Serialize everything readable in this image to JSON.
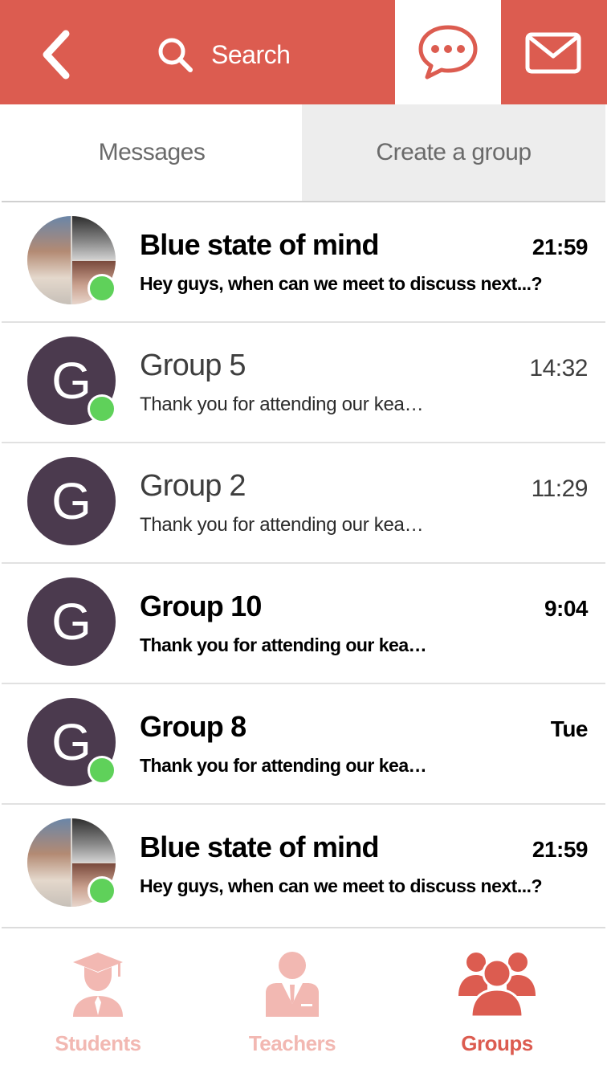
{
  "header": {
    "search_label": "Search",
    "accent_color": "#dc5c50"
  },
  "tabs": [
    {
      "label": "Messages",
      "active": true
    },
    {
      "label": "Create a group",
      "active": false
    }
  ],
  "conversations": [
    {
      "title": "Blue state of mind",
      "message": "Hey guys, when can we meet to discuss next...?",
      "time": "21:59",
      "avatar": "photo-collage",
      "online": true,
      "unread": true
    },
    {
      "title": "Group 5",
      "message": "Thank you for attending our kea…",
      "time": "14:32",
      "avatar_letter": "G",
      "online": true,
      "unread": false
    },
    {
      "title": "Group 2",
      "message": "Thank you for attending our kea…",
      "time": "11:29",
      "avatar_letter": "G",
      "online": false,
      "unread": false
    },
    {
      "title": "Group 10",
      "message": "Thank you for attending our kea…",
      "time": "9:04",
      "avatar_letter": "G",
      "online": false,
      "unread": true
    },
    {
      "title": "Group 8",
      "message": "Thank you for attending our kea…",
      "time": "Tue",
      "avatar_letter": "G",
      "online": true,
      "unread": true
    },
    {
      "title": "Blue state of mind",
      "message": "Hey guys, when can we meet to discuss next...?",
      "time": "21:59",
      "avatar": "photo-collage",
      "online": true,
      "unread": true
    }
  ],
  "bottom_nav": [
    {
      "label": "Students",
      "icon": "graduate-icon",
      "active": false
    },
    {
      "label": "Teachers",
      "icon": "teacher-icon",
      "active": false
    },
    {
      "label": "Groups",
      "icon": "group-icon",
      "active": true
    }
  ],
  "colors": {
    "online": "#5fd15a",
    "group_avatar": "#4b3a4e",
    "inactive_nav": "#f2b8b2"
  }
}
